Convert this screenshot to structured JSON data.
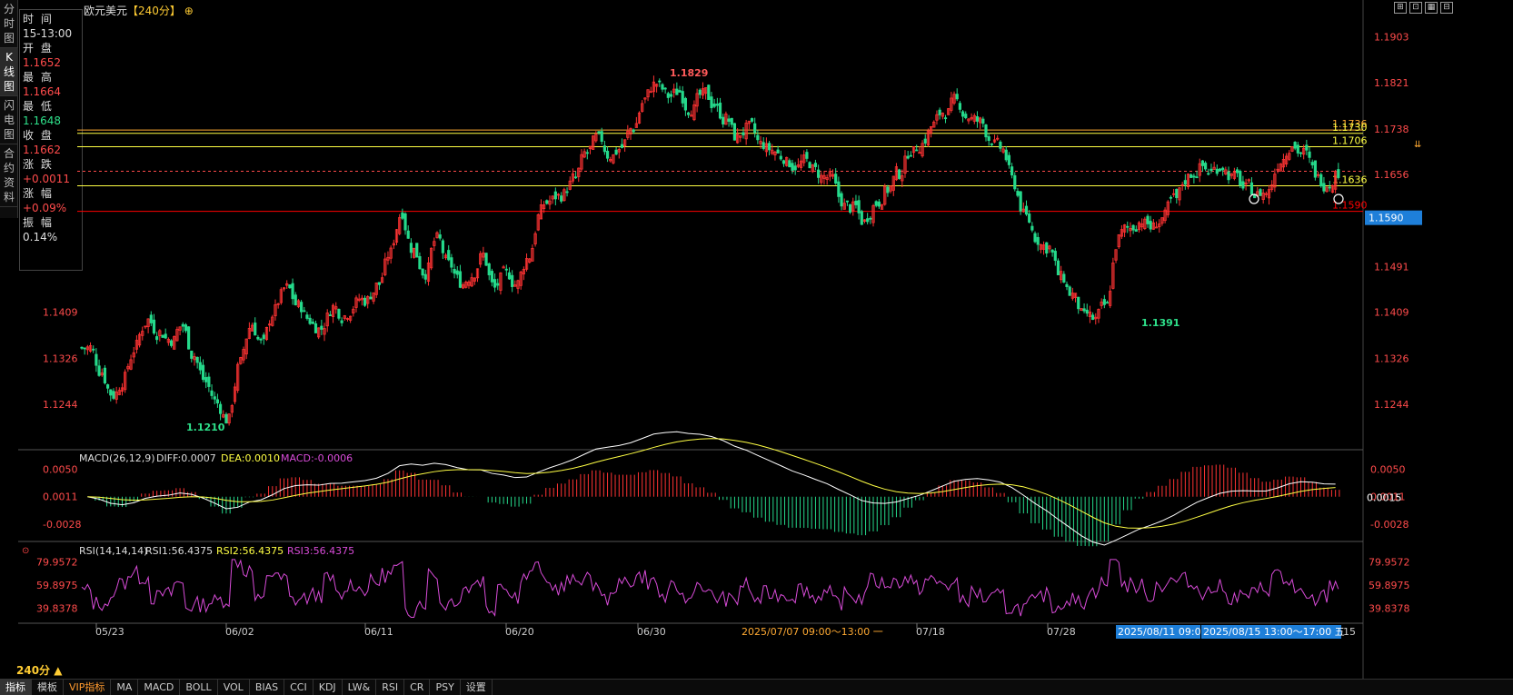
{
  "window": {
    "title": "欧元美元",
    "period": "【240分】",
    "title_icon": "plus-circle-icon"
  },
  "side_tabs": [
    {
      "label": "分时图",
      "active": false
    },
    {
      "label": "K线图",
      "active": true
    },
    {
      "label": "闪电图",
      "active": false
    },
    {
      "label": "合约资料",
      "active": false
    }
  ],
  "info": {
    "time_label": "时 间",
    "time": "15-13:00",
    "open_label": "开 盘",
    "open": "1.1652",
    "high_label": "最 高",
    "high": "1.1664",
    "low_label": "最 低",
    "low": "1.1648",
    "close_label": "收 盘",
    "close": "1.1662",
    "change_label": "涨 跌",
    "change": "+0.0011",
    "pct_label": "涨 幅",
    "pct": "+0.09%",
    "amp_label": "振 幅",
    "amp": "0.14%"
  },
  "colors": {
    "up": "#ff3333",
    "down": "#25d98b",
    "axis_text_red": "#ff4b4b",
    "yellow": "#ffff44",
    "orange": "#ffaa33",
    "magenta": "#d84bd8",
    "highlight_blue": "#1e7fd9"
  },
  "price_axis": {
    "labels": [
      "1.1903",
      "1.1821",
      "1.1738",
      "1.1656",
      "1.1491",
      "1.1409",
      "1.1326",
      "1.1244"
    ],
    "left_labels": [
      "1.1409",
      "1.1326",
      "1.1244"
    ],
    "current_price": "1.1590"
  },
  "h_lines": [
    {
      "value": "1.1736",
      "color": "orange"
    },
    {
      "value": "1.1730",
      "color": "yellow"
    },
    {
      "value": "1.1706",
      "color": "yellow"
    },
    {
      "value": "1.1636",
      "color": "yellow"
    },
    {
      "value": "1.1590",
      "color": "red"
    }
  ],
  "annotations": {
    "high": "1.1829",
    "low_left": "1.1210",
    "low_mid": "1.1391"
  },
  "macd": {
    "title": "MACD(26,12,9)",
    "diff": "DIFF:0.0007",
    "dea": "DEA:0.0010",
    "macd": "MACD:-0.0006",
    "axis": [
      "0.0050",
      "0.0011",
      "-0.0028"
    ],
    "current": "0.0015"
  },
  "rsi": {
    "title": "RSI(14,14,14)",
    "rsi1": "RSI1:56.4375",
    "rsi2": "RSI2:56.4375",
    "rsi3": "RSI3:56.4375",
    "axis": [
      "79.9572",
      "59.8975",
      "39.8378"
    ]
  },
  "x_axis": {
    "labels": [
      "05/23",
      "06/02",
      "06/11",
      "06/20",
      "06/30",
      "07/18",
      "07/28"
    ],
    "crosshair_range": "2025/07/07 09:00～13:00 一",
    "sel_start": "2025/08/11 09:0",
    "sel_end": "2025/08/15 13:00～17:00 五",
    "tail": "15"
  },
  "period_label": "240分 ▲",
  "bottom_tabs": [
    "指标",
    "模板",
    "VIP指标",
    "MA",
    "MACD",
    "BOLL",
    "VOL",
    "BIAS",
    "CCI",
    "KDJ",
    "LW&",
    "RSI",
    "CR",
    "PSY",
    "设置"
  ],
  "chart_data": {
    "type": "candlestick",
    "title": "欧元美元",
    "ylim": [
      1.119,
      1.194
    ],
    "x_range": [
      "05/23",
      "08/15"
    ],
    "closes": [
      1.1345,
      1.1302,
      1.1261,
      1.129,
      1.1348,
      1.1395,
      1.1372,
      1.136,
      1.1385,
      1.1331,
      1.1284,
      1.1246,
      1.1215,
      1.1318,
      1.1388,
      1.1352,
      1.1412,
      1.1452,
      1.142,
      1.1395,
      1.138,
      1.1418,
      1.1402,
      1.1425,
      1.143,
      1.146,
      1.1515,
      1.159,
      1.152,
      1.148,
      1.154,
      1.1495,
      1.1465,
      1.1475,
      1.1512,
      1.1452,
      1.1478,
      1.146,
      1.151,
      1.159,
      1.161,
      1.162,
      1.165,
      1.1695,
      1.172,
      1.169,
      1.1705,
      1.174,
      1.179,
      1.182,
      1.1798,
      1.1805,
      1.1775,
      1.1798,
      1.1782,
      1.1755,
      1.172,
      1.174,
      1.171,
      1.17,
      1.1688,
      1.1672,
      1.168,
      1.166,
      1.165,
      1.161,
      1.1595,
      1.157,
      1.1605,
      1.163,
      1.166,
      1.17,
      1.171,
      1.1745,
      1.177,
      1.1788,
      1.176,
      1.175,
      1.172,
      1.17,
      1.164,
      1.158,
      1.154,
      1.1525,
      1.147,
      1.144,
      1.14,
      1.1395,
      1.142,
      1.154,
      1.156,
      1.1575,
      1.156,
      1.158,
      1.1612,
      1.165,
      1.1665,
      1.166,
      1.1672,
      1.165,
      1.163,
      1.1618,
      1.1625,
      1.1682,
      1.1712,
      1.1695,
      1.166,
      1.164,
      1.1662
    ],
    "high_marker": 1.1829,
    "low_markers": [
      1.121,
      1.1391
    ],
    "macd_diff_last": 0.0007,
    "macd_dea_last": 0.001,
    "macd_hist_last": -0.0006,
    "macd_ylim": [
      -0.0045,
      0.0065
    ],
    "rsi_last": 56.4375,
    "rsi_ylim": [
      30,
      85
    ]
  }
}
